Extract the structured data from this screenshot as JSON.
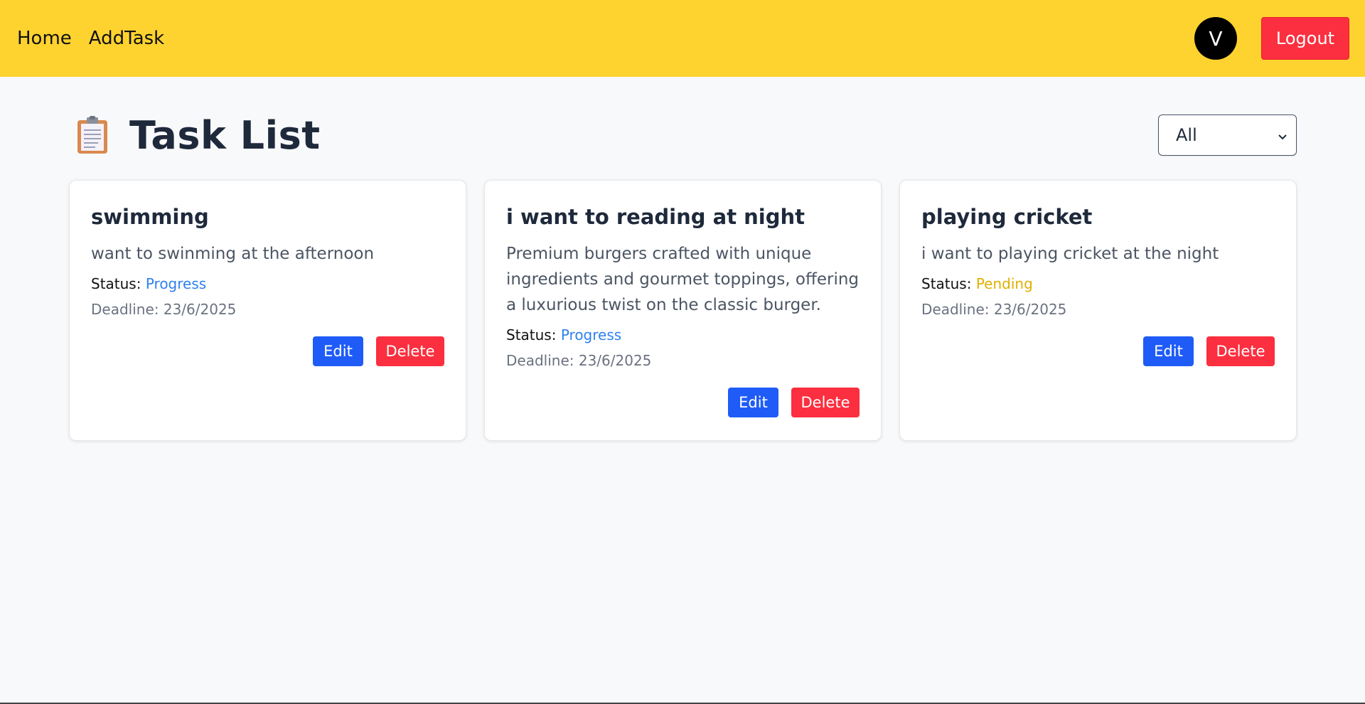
{
  "nav": {
    "links": [
      "Home",
      "AddTask"
    ],
    "avatar_initial": "V",
    "logout_label": "Logout",
    "bg_color": "#ffd32f"
  },
  "header": {
    "icon": "clipboard-icon",
    "title": "Task List",
    "filter": {
      "selected": "All"
    }
  },
  "tasks": [
    {
      "title": "swimming",
      "description": "want to swinming at the afternoon",
      "status_label": "Status:",
      "status": "Progress",
      "status_color": "#2f80ed",
      "deadline": "Deadline: 23/6/2025",
      "edit_label": "Edit",
      "delete_label": "Delete"
    },
    {
      "title": "i want to reading at night",
      "description": "Premium burgers crafted with unique ingredients and gourmet toppings, offering a luxurious twist on the classic burger.",
      "status_label": "Status:",
      "status": "Progress",
      "status_color": "#2f80ed",
      "deadline": "Deadline: 23/6/2025",
      "edit_label": "Edit",
      "delete_label": "Delete"
    },
    {
      "title": "playing cricket",
      "description": "i want to playing cricket at the night",
      "status_label": "Status:",
      "status": "Pending",
      "status_color": "#e0b000",
      "deadline": "Deadline: 23/6/2025",
      "edit_label": "Edit",
      "delete_label": "Delete"
    }
  ],
  "colors": {
    "edit_button": "#1f5cf7",
    "delete_button": "#fb2f3f",
    "logout_button": "#fb2f3f"
  }
}
